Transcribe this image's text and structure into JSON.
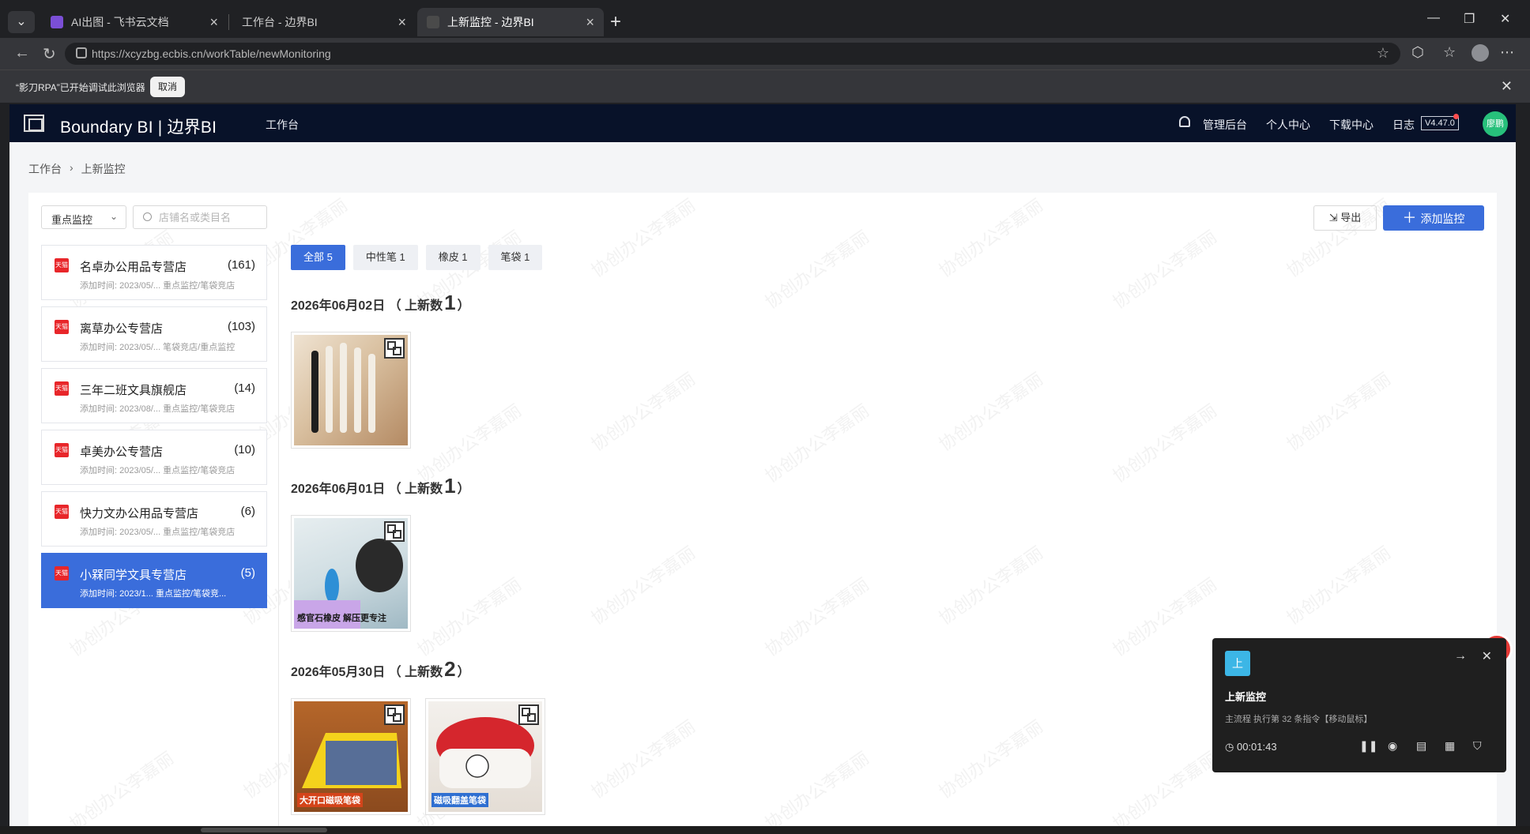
{
  "browser": {
    "tabs": [
      {
        "title": "AI出图 - 飞书云文档",
        "active": false,
        "icon_color": "#7b4fd6"
      },
      {
        "title": "工作台 - 边界BI",
        "active": false,
        "icon_color": ""
      },
      {
        "title": "上新监控 - 边界BI",
        "active": true,
        "icon_color": "#4a4a4a"
      }
    ],
    "url": "https://xcyzbg.ecbis.cn/workTable/newMonitoring",
    "infobar": {
      "message": "“影刀RPA”已开始调试此浏览器",
      "cancel_label": "取消"
    }
  },
  "header": {
    "brand": "Boundary BI | 边界BI",
    "nav_work": "工作台",
    "links": [
      "管理后台",
      "个人中心",
      "下载中心",
      "日志"
    ],
    "version": "V4.47.0",
    "user_initials": "廖鹏",
    "colors": {
      "bg": "#081229",
      "avatar": "#27c07b"
    }
  },
  "breadcrumb": [
    "工作台",
    "上新监控"
  ],
  "toolbar": {
    "filter_value": "重点监控",
    "search_placeholder": "店铺名或类目名",
    "export_label": "导出",
    "add_label": "添加监控",
    "accent": "#3a6ddb"
  },
  "stores": [
    {
      "name": "名卓办公用品专营店",
      "count": "(161)",
      "meta": "添加时间: 2023/05/... 重点监控/笔袋竞店",
      "active": false
    },
    {
      "name": "离草办公专营店",
      "count": "(103)",
      "meta": "添加时间: 2023/05/... 笔袋竞店/重点监控",
      "active": false
    },
    {
      "name": "三年二班文具旗舰店",
      "count": "(14)",
      "meta": "添加时间: 2023/08/... 重点监控/笔袋竞店",
      "active": false
    },
    {
      "name": "卓美办公专营店",
      "count": "(10)",
      "meta": "添加时间: 2023/05/... 重点监控/笔袋竞店",
      "active": false
    },
    {
      "name": "快力文办公用品专营店",
      "count": "(6)",
      "meta": "添加时间: 2023/05/... 重点监控/笔袋竞店",
      "active": false
    },
    {
      "name": "小槑同学文具专营店",
      "count": "(5)",
      "meta": "添加时间: 2023/1... 重点监控/笔袋竞...",
      "active": true
    }
  ],
  "store_badge": "天猫",
  "category_tabs": [
    {
      "label": "全部 5",
      "active": true
    },
    {
      "label": "中性笔 1",
      "active": false
    },
    {
      "label": "橡皮 1",
      "active": false
    },
    {
      "label": "笔袋 1",
      "active": false
    }
  ],
  "groups": [
    {
      "date": "2026年06月02日",
      "prefix": "（ 上新数",
      "count": "1",
      "suffix": "）"
    },
    {
      "date": "2026年06月01日",
      "prefix": "（ 上新数",
      "count": "1",
      "suffix": "）"
    },
    {
      "date": "2026年05月30日",
      "prefix": "（ 上新数",
      "count": "2",
      "suffix": "）"
    }
  ],
  "product_captions": [
    "",
    "感官石橡皮 解压更专注",
    "大开口磁吸笔袋",
    "磁吸翻盖笔袋"
  ],
  "watermark": "协创办公李嘉丽",
  "rpa": {
    "badge": "上",
    "title": "上新监控",
    "status": "主流程 执行第 32 条指令【移动鼠标】",
    "timer": "00:01:43"
  }
}
